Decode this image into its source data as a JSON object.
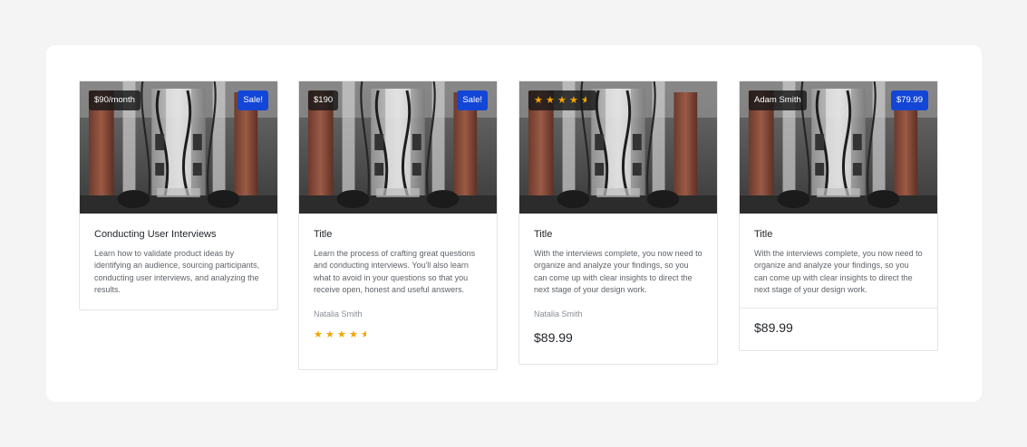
{
  "colors": {
    "accent_blue": "#1346d6",
    "star": "#f5a300",
    "panel": "#ffffff",
    "page": "#f4f4f5"
  },
  "cards": [
    {
      "badge_left": "$90/month",
      "badge_right": "Sale!",
      "title": "Conducting User Interviews",
      "description": "Learn how to validate product ideas by identifying an audience, sourcing participants, conducting user interviews, and analyzing the results."
    },
    {
      "badge_left": "$190",
      "badge_right": "Sale!",
      "title": "Title",
      "description": "Learn the process of crafting great questions and conducting interviews. You'll also learn what to avoid in your questions so that you receive open, honest and useful answers.",
      "author": "Natalia Smith",
      "rating": 4.5
    },
    {
      "badge_rating": 4.5,
      "title": "Title",
      "description": "With the interviews complete, you now need to organize and analyze your findings, so you can come up with clear insights to direct the next stage of your design work.",
      "author": "Natalia Smith",
      "price": "$89.99"
    },
    {
      "badge_left": "Adam Smith",
      "badge_right": "$79.99",
      "title": "Title",
      "description": "With the interviews complete, you now need to organize and analyze your findings, so you can come up with clear insights to direct the next stage of your design work.",
      "price": "$89.99"
    }
  ]
}
